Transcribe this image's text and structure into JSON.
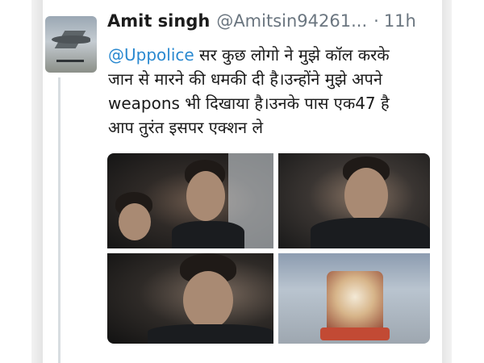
{
  "tweet": {
    "author_name": "Amit singh",
    "author_handle": "@Amitsin94261...",
    "separator": "·",
    "time": "11h",
    "text": {
      "mention": "@Uppolice",
      "line1_rest": " सर कुछ लोगो ने मुझे कॉल करके",
      "line2": "जान से मारने की धमकी दी है।उन्होंने मुझे अपने",
      "line3": "weapons भी दिखाया है।उनके पास एक47 है",
      "line4": "आप तुरंत इसपर एक्शन ले"
    }
  },
  "media": {
    "photo_count": 4
  },
  "icons": {
    "avatar": "fighter-jet-avatar"
  },
  "colors": {
    "mention": "#2a89d0",
    "secondary_text": "#6b7680",
    "primary_text": "#1a1a1a"
  }
}
